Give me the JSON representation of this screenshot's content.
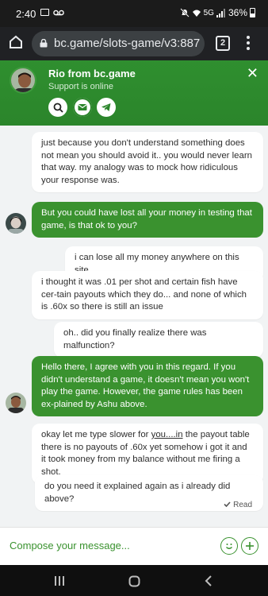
{
  "status_bar": {
    "time": "2:40",
    "network": "5G",
    "battery": "36%"
  },
  "browser": {
    "url": "bc.game/slots-game/v3:887",
    "tab_count": "2"
  },
  "chat_header": {
    "agent_name": "Rio from bc.game",
    "agent_status": "Support is online",
    "accent_color": "#2e8b2e"
  },
  "messages": [
    {
      "side": "in",
      "text": "just because you don't understand something does not mean you should avoid it.. you would never learn that way. my analogy was to mock how ridiculous your response was."
    },
    {
      "side": "out",
      "text": "But you could have lost all your money in testing that game, is that ok to you?"
    },
    {
      "side": "in",
      "text": "i can lose all my money anywhere on this site.."
    },
    {
      "side": "in",
      "text": "i thought it was .01 per shot and certain fish have cer-tain payouts which they do... and none of which is .60x so there is still an issue"
    },
    {
      "side": "in",
      "text": "oh.. did you finally realize there was malfunction?"
    },
    {
      "side": "out",
      "text": "Hello there, I agree with you in this regard. If you didn't understand a game, it doesn't mean you won't play the game. However, the game rules has been ex-plained by Ashu above."
    },
    {
      "side": "in",
      "text_before": "okay let me type slower for ",
      "link": "you....in",
      "text_after": " the payout table there is no payouts of .60x yet somehow i got it and it took money from my balance without me firing a shot."
    },
    {
      "side": "in",
      "text": "do you need it explained again as i already did above?"
    }
  ],
  "read_receipt": "Read",
  "composer": {
    "placeholder": "Compose your message..."
  }
}
